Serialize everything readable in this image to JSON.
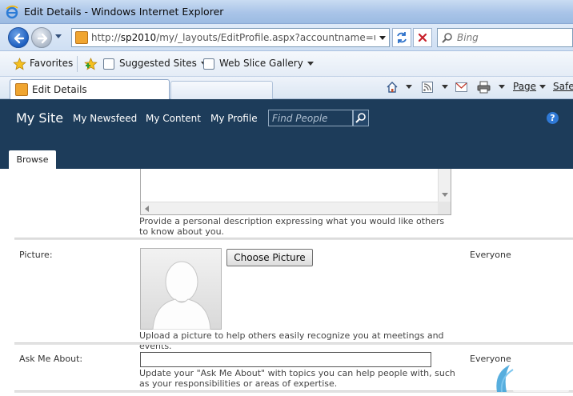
{
  "window": {
    "title": "Edit Details - Windows Internet Explorer"
  },
  "address_bar": {
    "url_prefix": "http://",
    "url_host": "sp2010",
    "url_rest": "/my/_layouts/EditProfile.aspx?accountname=ucdemo"
  },
  "search": {
    "placeholder": "Bing"
  },
  "favorites_bar": {
    "favorites_label": "Favorites",
    "items": [
      "Suggested Sites",
      "Web Slice Gallery"
    ]
  },
  "tabs": {
    "active_label": "Edit Details"
  },
  "command_bar": {
    "page_label": "Page",
    "safety_label": "Safety"
  },
  "sharepoint": {
    "site_title": "My Site",
    "nav": [
      "My Newsfeed",
      "My Content",
      "My Profile"
    ],
    "find_placeholder": "Find People",
    "help_label": "?",
    "ribbon_tab": "Browse"
  },
  "form": {
    "about_me": {
      "hint": "Provide a personal description expressing what you would like others to know about you."
    },
    "picture": {
      "label": "Picture:",
      "button_label": "Choose Picture",
      "hint": "Upload a picture to help others easily recognize you at meetings and events.",
      "privacy": "Everyone"
    },
    "ask_me_about": {
      "label": "Ask Me About:",
      "value": "",
      "hint": "Update your \"Ask Me About\" with topics you can help people with, such as your responsibilities or areas of expertise.",
      "privacy": "Everyone"
    }
  },
  "colors": {
    "sharepoint_header": "#1d3c5a",
    "ie_chrome": "#cfdff3",
    "accent_blue": "#1d5fc0"
  }
}
